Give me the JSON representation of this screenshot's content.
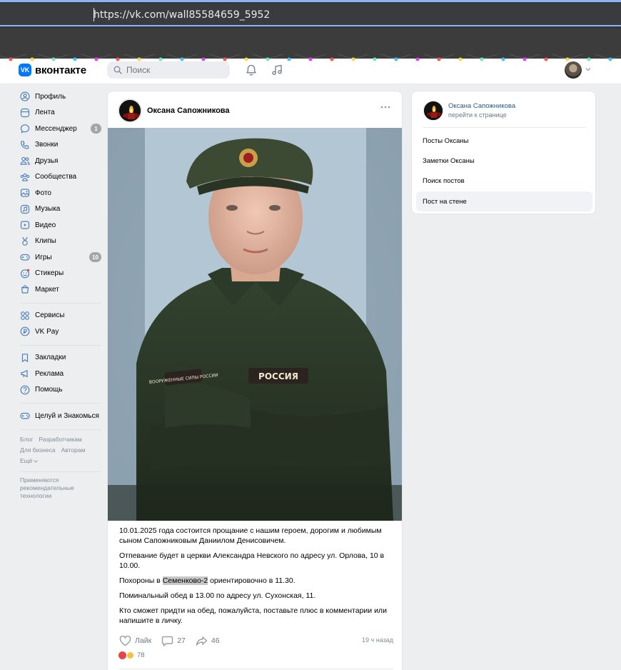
{
  "browser": {
    "url": "https://vk.com/wall85584659_5952"
  },
  "header": {
    "logo_mark": "VK",
    "logo_text": "вконтакте",
    "search_placeholder": "Поиск",
    "icons": [
      "search-icon",
      "bell-icon",
      "music-icon",
      "chevron-down-icon"
    ]
  },
  "sidebar": {
    "items": [
      {
        "label": "Профиль",
        "icon": "profile-icon"
      },
      {
        "label": "Лента",
        "icon": "feed-icon"
      },
      {
        "label": "Мессенджер",
        "icon": "messenger-icon",
        "badge": "1"
      },
      {
        "label": "Звонки",
        "icon": "phone-icon"
      },
      {
        "label": "Друзья",
        "icon": "friends-icon"
      },
      {
        "label": "Сообщества",
        "icon": "communities-icon"
      },
      {
        "label": "Фото",
        "icon": "photo-icon"
      },
      {
        "label": "Музыка",
        "icon": "music-icon"
      },
      {
        "label": "Видео",
        "icon": "video-icon"
      },
      {
        "label": "Клипы",
        "icon": "clips-icon"
      },
      {
        "label": "Игры",
        "icon": "games-icon",
        "badge": "10"
      },
      {
        "label": "Стикеры",
        "icon": "stickers-icon"
      },
      {
        "label": "Маркет",
        "icon": "market-icon"
      }
    ],
    "items2": [
      {
        "label": "Сервисы",
        "icon": "services-icon"
      },
      {
        "label": "VK Pay",
        "icon": "vkpay-icon"
      }
    ],
    "items3": [
      {
        "label": "Закладки",
        "icon": "bookmark-icon"
      },
      {
        "label": "Реклама",
        "icon": "ads-icon"
      },
      {
        "label": "Помощь",
        "icon": "help-icon"
      }
    ],
    "items4": [
      {
        "label": "Целуй и Знакомься",
        "icon": "gamepad-icon"
      }
    ],
    "footer_links": [
      "Блог",
      "Разработчикам",
      "Для бизнеса",
      "Авторам",
      "Ещё"
    ],
    "footer_note": "Применяются рекомендательные технологии"
  },
  "post": {
    "author": "Оксана Сапожникова",
    "paragraphs": [
      "10.01.2025 года состоится прощание с нашим героем, дорогим и любимым сыном Сапожниковым Даниилом Денисовичем.",
      "Отпевание будет в церкви Александра Невского по адресу ул. Орлова, 10 в 10.00.",
      "Похороны в",
      "Поминальный обед в 13.00 по адресу ул. Сухонская, 11.",
      "Кто сможет придти на обед, пожалуйста, поставьте плюс в комментарии или напишите в личку."
    ],
    "funeral_place": "Семенково-2",
    "funeral_time": "ориентировочно в 11.30.",
    "photo_patch_text": "РОССИЯ",
    "photo_sleeve_text": "ВООРУЖЕННЫЕ СИЛЫ РОССИИ",
    "like_label": "Лайк",
    "comments": "27",
    "shares": "46",
    "time": "19 ч назад",
    "reactions_count": "78"
  },
  "right_card": {
    "name": "Оксана Сапожникова",
    "subtitle": "перейти к странице",
    "menu": [
      {
        "label": "Посты Оксаны",
        "active": false
      },
      {
        "label": "Заметки Оксаны",
        "active": false
      },
      {
        "label": "Поиск постов",
        "active": false
      },
      {
        "label": "Пост на стене",
        "active": true
      }
    ]
  },
  "colors": {
    "accent": "#0077ff",
    "link": "#2a5885",
    "badge": "#a2a5aa",
    "page_bg": "#edeef0"
  }
}
